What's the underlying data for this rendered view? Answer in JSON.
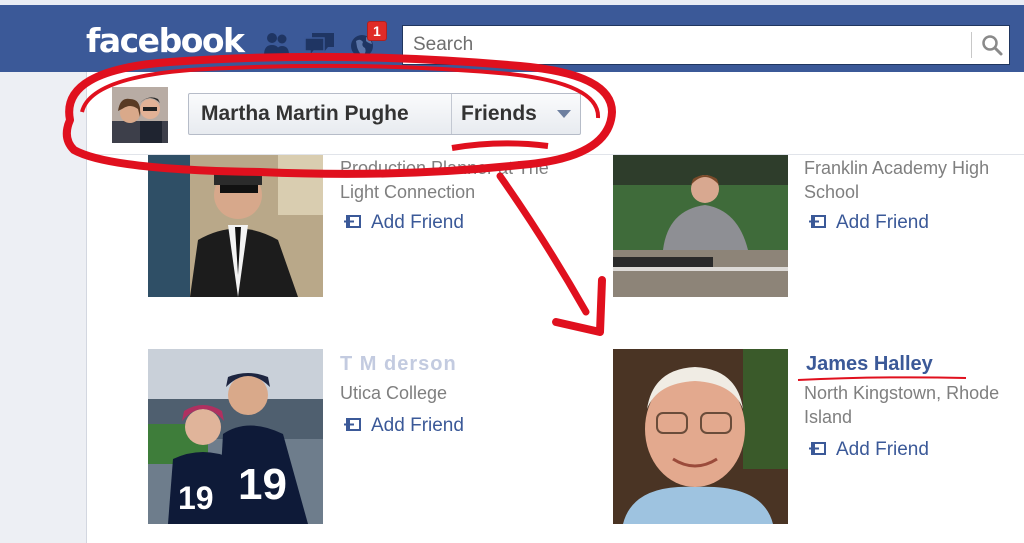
{
  "app": {
    "logo": "facebook"
  },
  "topbar": {
    "notifications_count": "1",
    "search_placeholder": "Search"
  },
  "profile": {
    "name": "Martha Martin Pughe",
    "relationship_button": "Friends"
  },
  "cards": [
    {
      "subtitle_lines": [
        "Production Planner at The",
        "Light Connection"
      ],
      "action": "Add Friend"
    },
    {
      "subtitle_lines": [
        "Franklin Academy High",
        "School"
      ],
      "action": "Add Friend"
    },
    {
      "name": "T    M    derson",
      "subtitle_lines": [
        "Utica College"
      ],
      "action": "Add Friend"
    },
    {
      "name": "James Halley",
      "subtitle_lines": [
        "North Kingstown, Rhode",
        "Island"
      ],
      "action": "Add Friend"
    }
  ],
  "colors": {
    "brand_blue": "#3b5998",
    "annotation_red": "#e0101e",
    "badge_red": "#e02b27"
  },
  "icons": [
    "friends-icon",
    "messages-icon",
    "globe-icon",
    "search-icon",
    "add-friend-icon",
    "dropdown-arrow-icon"
  ]
}
